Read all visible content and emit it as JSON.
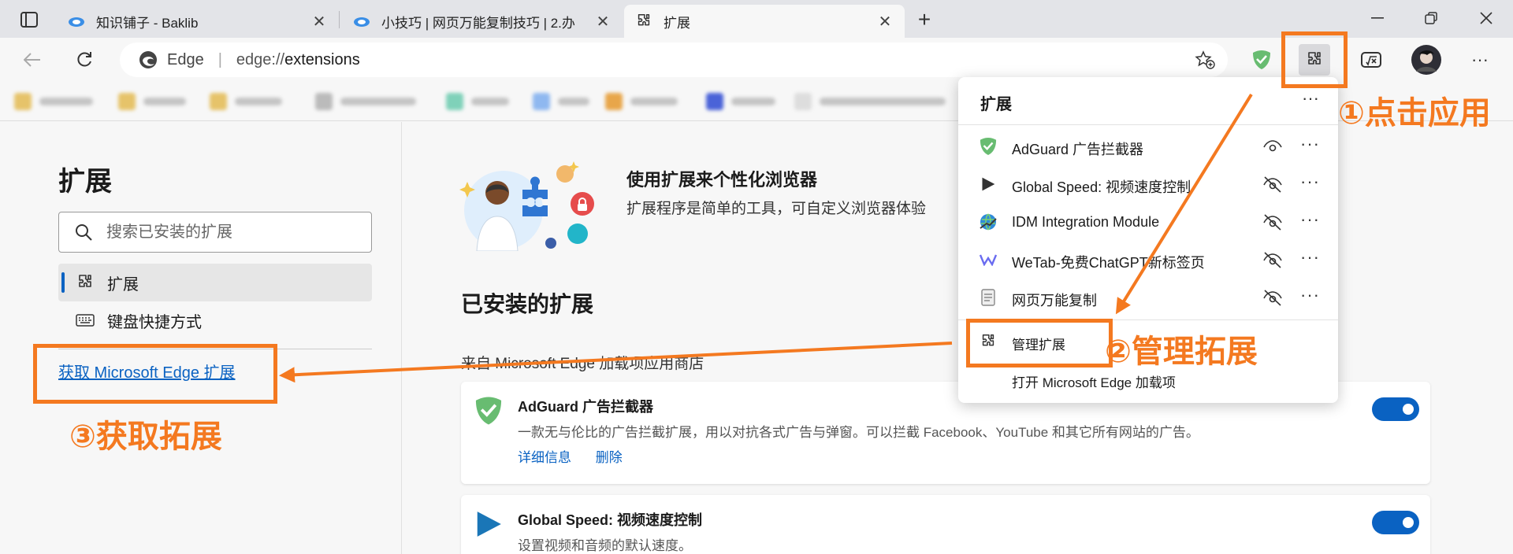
{
  "tabs": [
    {
      "title": "知识铺子 - Baklib",
      "close": "✕"
    },
    {
      "title": "小技巧 | 网页万能复制技巧 | 2.办",
      "close": "✕"
    },
    {
      "title": "扩展",
      "close": "✕"
    }
  ],
  "new_tab": "+",
  "address": {
    "edge_label": "Edge",
    "separator": "|",
    "url_prefix": "edge://",
    "url_path": "extensions"
  },
  "left_panel": {
    "title": "扩展",
    "search_placeholder": "搜索已安装的扩展",
    "nav": [
      {
        "label": "扩展"
      },
      {
        "label": "键盘快捷方式"
      }
    ],
    "get_link": "获取 Microsoft Edge 扩展"
  },
  "main": {
    "hero_title": "使用扩展来个性化浏览器",
    "hero_desc": "扩展程序是简单的工具，可自定义浏览器体验",
    "installed_title": "已安装的扩展",
    "source_label": "来自 Microsoft Edge 加载项应用商店",
    "cards": [
      {
        "name": "AdGuard 广告拦截器",
        "desc": "一款无与伦比的广告拦截扩展，用以对抗各式广告与弹窗。可以拦截 Facebook、YouTube 和其它所有网站的广告。",
        "details": "详细信息",
        "remove": "删除",
        "enabled": true
      },
      {
        "name": "Global Speed: 视频速度控制",
        "desc": "设置视频和音频的默认速度。",
        "enabled": true
      }
    ]
  },
  "popup": {
    "title": "扩展",
    "more": "···",
    "items": [
      {
        "name": "AdGuard 广告拦截器",
        "icon": "adguard-shield-icon",
        "visible": true
      },
      {
        "name": "Global Speed: 视频速度控制",
        "icon": "play-triangle-icon",
        "visible": false
      },
      {
        "name": "IDM Integration Module",
        "icon": "idm-globe-icon",
        "visible": false
      },
      {
        "name": "WeTab-免费ChatGPT新标签页",
        "icon": "wetab-icon",
        "visible": false
      },
      {
        "name": "网页万能复制",
        "icon": "copy-doc-icon",
        "visible": false
      }
    ],
    "item_more": "···",
    "manage": "管理扩展",
    "open_addons": "打开 Microsoft Edge 加载项"
  },
  "annotations": {
    "step1": "①点击应用",
    "step2": "②管理拓展",
    "step3": "③获取拓展"
  },
  "colors": {
    "accent": "#0a62c2",
    "annotation": "#f47920",
    "toggle_on": "#0a62c2"
  }
}
